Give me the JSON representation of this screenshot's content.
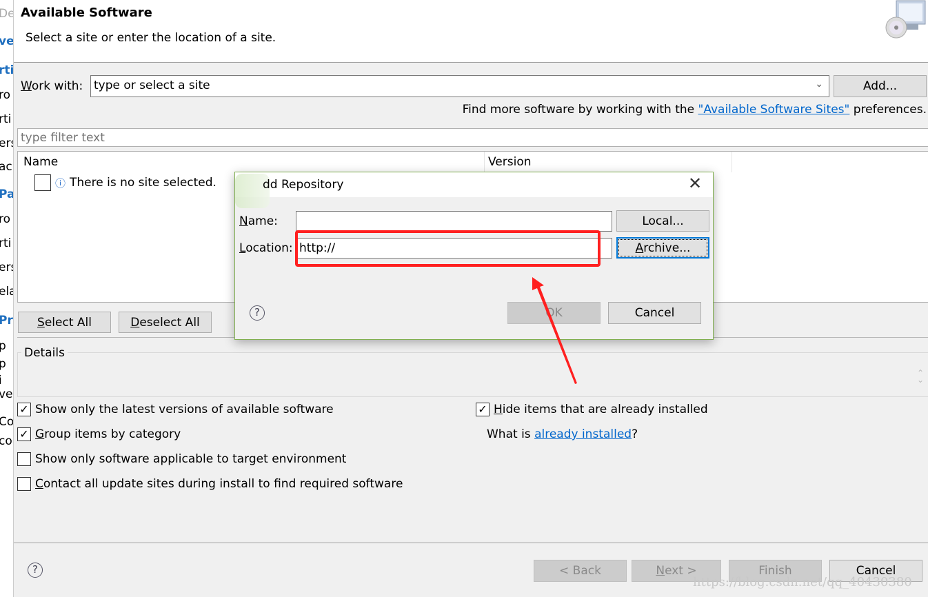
{
  "background_fragments": [
    "De",
    "ve",
    "rti",
    "ro",
    "rti",
    "ers",
    "acl",
    "Pa",
    "ro",
    "rti",
    "ers",
    "ela",
    "Pr",
    "p",
    "p",
    "i",
    "ver",
    "Co",
    "co"
  ],
  "wizard": {
    "title": "Available Software",
    "subtitle": "Select a site or enter the location of a site.",
    "work_with_label": "Work with:",
    "work_with_value": "type or select a site",
    "add_button": "Add...",
    "find_more_prefix": "Find more software by working with the ",
    "find_more_link": "\"Available Software Sites\"",
    "find_more_suffix": " preferences.",
    "filter_placeholder": "type filter text",
    "columns": [
      "Name",
      "Version"
    ],
    "rows": [
      {
        "name": "There is no site selected.",
        "checked": false
      }
    ],
    "select_all": "Select All",
    "deselect_all": "Deselect All",
    "details_label": "Details",
    "options": [
      {
        "label": "Show only the latest versions of available software",
        "checked": true
      },
      {
        "label": "Group items by category",
        "checked": true
      },
      {
        "label": "Show only software applicable to target environment",
        "checked": false
      },
      {
        "label": "Contact all update sites during install to find required software",
        "checked": false
      },
      {
        "label": "Hide items that are already installed",
        "checked": true
      }
    ],
    "what_is_prefix": "What is ",
    "what_is_link": "already installed",
    "what_is_suffix": "?",
    "back": "< Back",
    "next": "Next >",
    "finish": "Finish",
    "cancel": "Cancel"
  },
  "dialog": {
    "title": "dd Repository",
    "name_label": "Name:",
    "name_value": "",
    "location_label": "Location:",
    "location_value": "http://",
    "local_button": "Local...",
    "archive_button": "Archive...",
    "ok": "OK",
    "cancel": "Cancel"
  },
  "annotation_color": "#ff2020",
  "watermark": "https://blog.csdn.net/qq_40430380"
}
